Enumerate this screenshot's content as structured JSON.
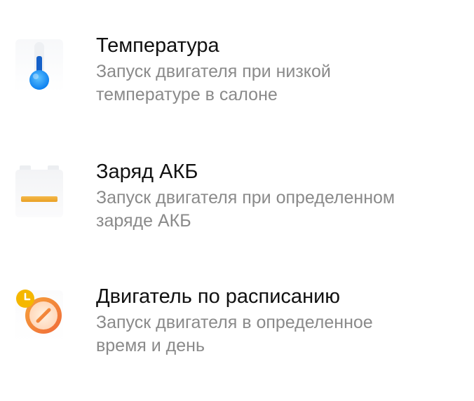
{
  "items": [
    {
      "icon": "thermometer-icon",
      "title": "Температура",
      "subtitle_lines": [
        "Запуск двигателя при низкой",
        "температуре в салоне"
      ]
    },
    {
      "icon": "battery-icon",
      "title": "Заряд АКБ",
      "subtitle_lines": [
        "Запуск двигателя при определенном",
        "заряде АКБ"
      ]
    },
    {
      "icon": "schedule-clock-icon",
      "title": "Двигатель по расписанию",
      "subtitle_lines": [
        "Запуск двигателя в определенное",
        "время и день"
      ]
    }
  ],
  "colors": {
    "title": "#111111",
    "subtitle": "#8a8a8a",
    "thermometer_blue": "#1a8cff",
    "battery_orange": "#f0a830",
    "schedule_orange": "#f07a3a",
    "schedule_yellow": "#f5b700"
  }
}
